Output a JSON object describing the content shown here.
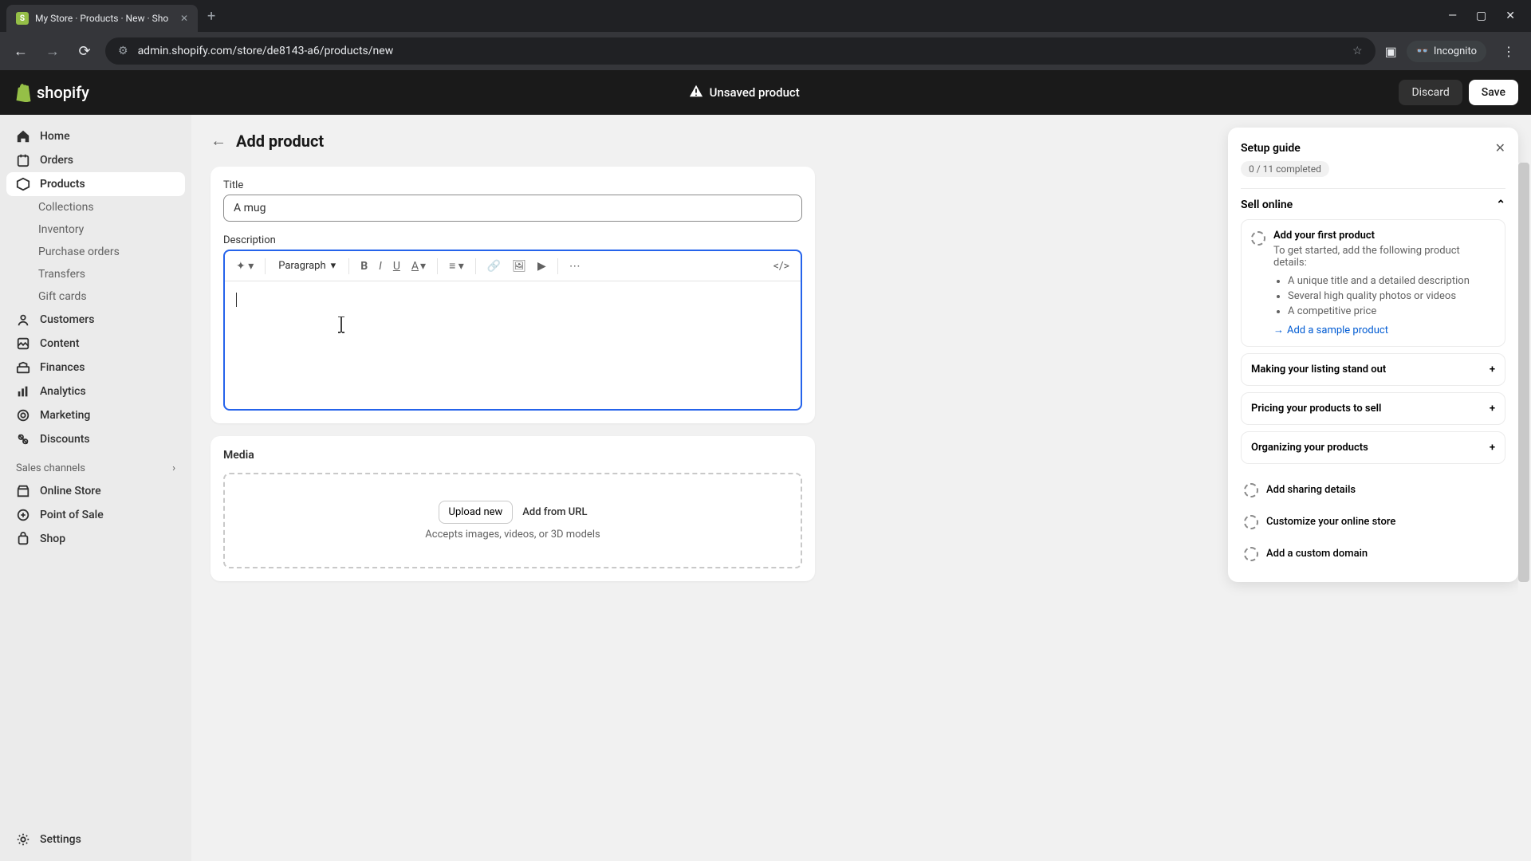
{
  "browser": {
    "tab_title": "My Store · Products · New · Sho",
    "url": "admin.shopify.com/store/de8143-a6/products/new",
    "incognito_label": "Incognito"
  },
  "topbar": {
    "logo_text": "shopify",
    "unsaved_label": "Unsaved product",
    "discard_label": "Discard",
    "save_label": "Save"
  },
  "sidebar": {
    "home": "Home",
    "orders": "Orders",
    "products": "Products",
    "collections": "Collections",
    "inventory": "Inventory",
    "purchase_orders": "Purchase orders",
    "transfers": "Transfers",
    "gift_cards": "Gift cards",
    "customers": "Customers",
    "content": "Content",
    "finances": "Finances",
    "analytics": "Analytics",
    "marketing": "Marketing",
    "discounts": "Discounts",
    "sales_channels": "Sales channels",
    "online_store": "Online Store",
    "pos": "Point of Sale",
    "shop": "Shop",
    "settings": "Settings"
  },
  "page": {
    "title": "Add product",
    "title_label": "Title",
    "title_value": "A mug",
    "desc_label": "Description",
    "paragraph_label": "Paragraph",
    "media_label": "Media",
    "upload_label": "Upload new",
    "add_url_label": "Add from URL",
    "media_hint": "Accepts images, videos, or 3D models"
  },
  "setup": {
    "title": "Setup guide",
    "progress": "0 / 11 completed",
    "sell_online": "Sell online",
    "task1_title": "Add your first product",
    "task1_desc": "To get started, add the following product details:",
    "task1_b1": "A unique title and a detailed description",
    "task1_b2": "Several high quality photos or videos",
    "task1_b3": "A competitive price",
    "task1_link": "Add a sample product",
    "task2": "Making your listing stand out",
    "task3": "Pricing your products to sell",
    "task4": "Organizing your products",
    "task5": "Add sharing details",
    "task6": "Customize your online store",
    "task7": "Add a custom domain"
  }
}
